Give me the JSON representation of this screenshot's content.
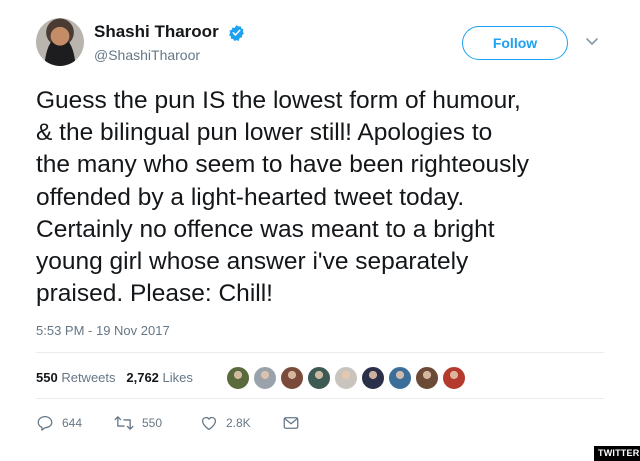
{
  "author": {
    "name": "Shashi Tharoor",
    "handle": "@ShashiTharoor",
    "verified": true
  },
  "follow_button": {
    "label": "Follow"
  },
  "tweet": {
    "lines": [
      "Guess the pun IS the lowest form of humour,",
      "& the bilingual pun lower still! Apologies to",
      "the many who seem to have been righteously",
      "offended by a light-hearted tweet today.",
      "Certainly no offence was meant to a bright",
      "young girl whose answer i've separately",
      "praised. Please: Chill!"
    ],
    "timestamp": "5:53 PM - 19 Nov 2017"
  },
  "stats": {
    "retweets_count": "550",
    "retweets_label": "Retweets",
    "likes_count": "2,762",
    "likes_label": "Likes"
  },
  "liker_avatars": [
    "#5b6a3d",
    "#9aa3ab",
    "#7a4b3a",
    "#3e5a55",
    "#c9c4bd",
    "#2a2f4a",
    "#3b6f9a",
    "#6b4a36",
    "#b43a2e"
  ],
  "actions": {
    "reply_count": "644",
    "retweet_count": "550",
    "like_count": "2.8K"
  },
  "watermark": "TWITTER",
  "colors": {
    "accent": "#1da1f2",
    "text": "#14171a",
    "muted": "#657786",
    "divider": "#e6ecf0"
  },
  "icons": [
    "verified-badge-icon",
    "chevron-down-icon",
    "reply-icon",
    "retweet-icon",
    "heart-icon",
    "direct-message-icon"
  ]
}
